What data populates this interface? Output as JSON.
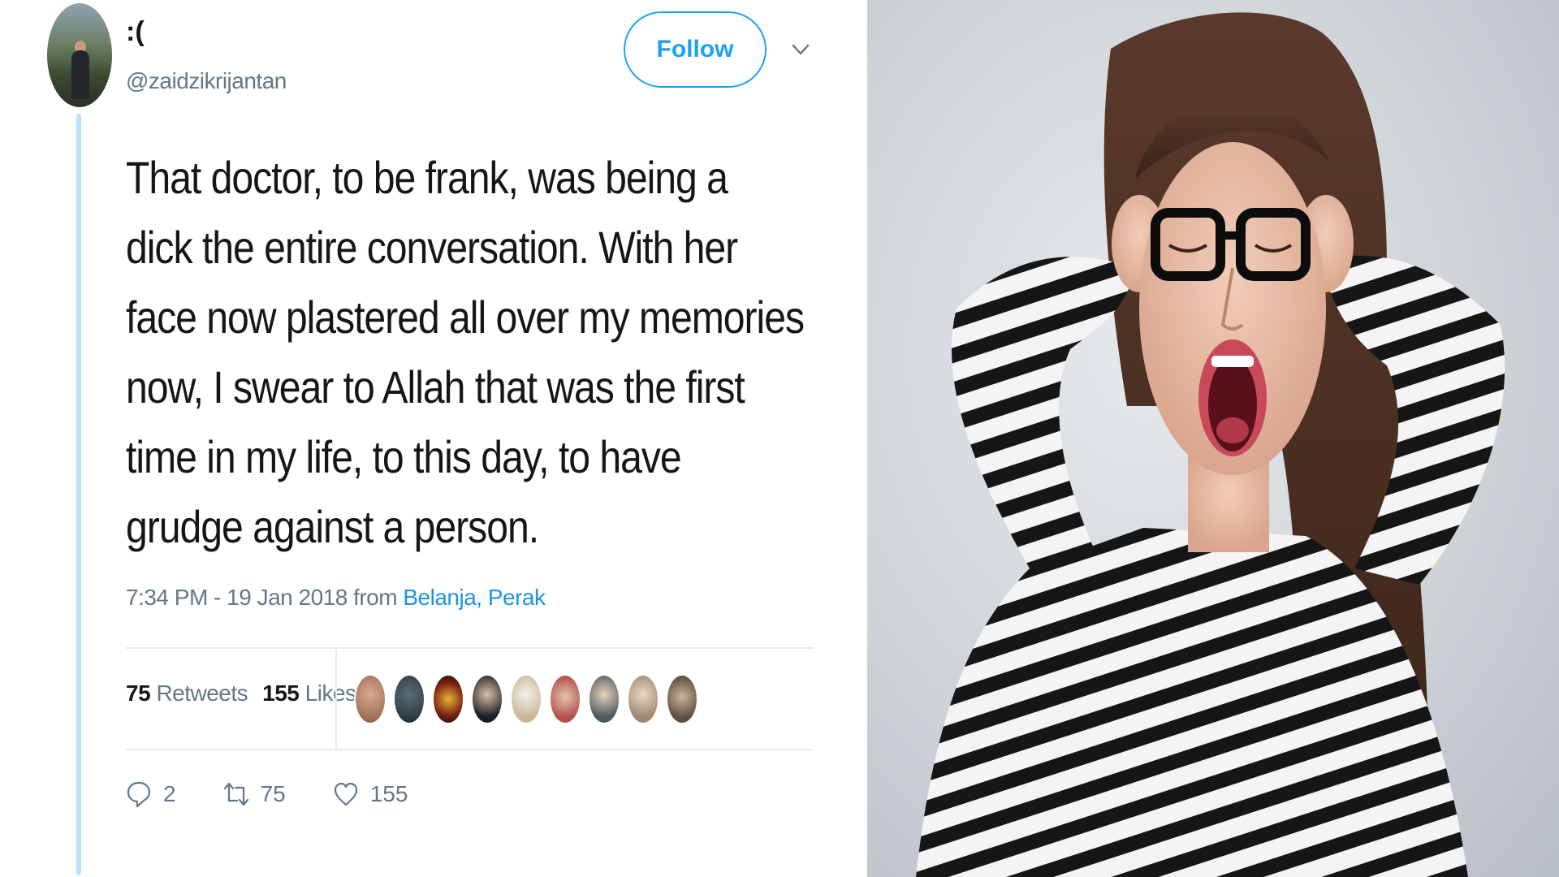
{
  "tweet": {
    "display_name": ":(",
    "handle": "@zaidzikrijantan",
    "follow_label": "Follow",
    "text_lines": [
      "That doctor, to be frank, was being a",
      "dick the entire conversation. With her",
      "face now plastered all over my memories",
      "now, I swear to Allah that was the first",
      "time in my life, to this day, to have",
      "grudge against a person."
    ],
    "timestamp": "7:34 PM - 19 Jan 2018 from",
    "location": "Belanja, Perak",
    "retweets_count": "75",
    "retweets_label": "Retweets",
    "likes_count": "155",
    "likes_label": "Likes",
    "actions": {
      "replies": "2",
      "retweets": "75",
      "likes": "155"
    },
    "colors": {
      "accent": "#1da1f2",
      "link": "#1b95e0",
      "secondary_text": "#657786",
      "thread_line": "#bfe1f5"
    }
  },
  "photo": {
    "icon": "photo-of-screaming-woman"
  }
}
